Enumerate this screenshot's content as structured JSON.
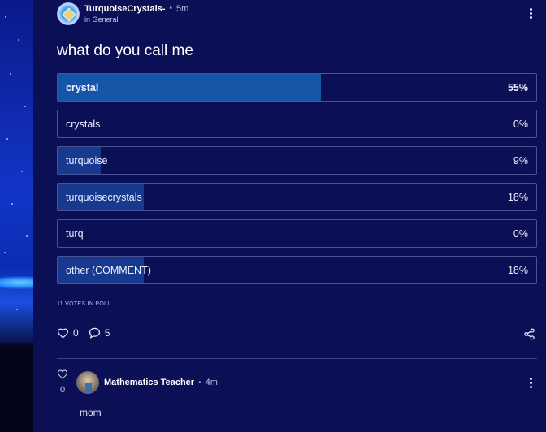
{
  "post": {
    "author": "TurquoiseCrystals-",
    "time": "5m",
    "community": "in General",
    "title": "what do you call me",
    "poll": {
      "options": [
        {
          "label": "crystal",
          "percent_text": "55%",
          "percent": 55,
          "leading": true
        },
        {
          "label": "crystals",
          "percent_text": "0%",
          "percent": 0,
          "leading": false
        },
        {
          "label": "turquoise",
          "percent_text": "9%",
          "percent": 9,
          "leading": false
        },
        {
          "label": "turquoisecrystals",
          "percent_text": "18%",
          "percent": 18,
          "leading": false
        },
        {
          "label": "turq",
          "percent_text": "0%",
          "percent": 0,
          "leading": false
        },
        {
          "label": "other (COMMENT)",
          "percent_text": "18%",
          "percent": 18,
          "leading": false
        }
      ],
      "votes_text": "11 VOTES IN POLL"
    },
    "likes": "0",
    "comments": "5"
  },
  "comment": {
    "author": "Mathematics Teacher",
    "time": "4m",
    "likes": "0",
    "body": "mom"
  },
  "icons": {
    "post_avatar": "avatar-icon",
    "more": "kebab-icon",
    "like": "heart-icon",
    "comment": "comment-icon",
    "share": "share-icon"
  },
  "colors": {
    "background": "#0b0f55",
    "option_border": "#4b5294",
    "leading_fill": "#1556a8",
    "fill": "#173a8f"
  }
}
